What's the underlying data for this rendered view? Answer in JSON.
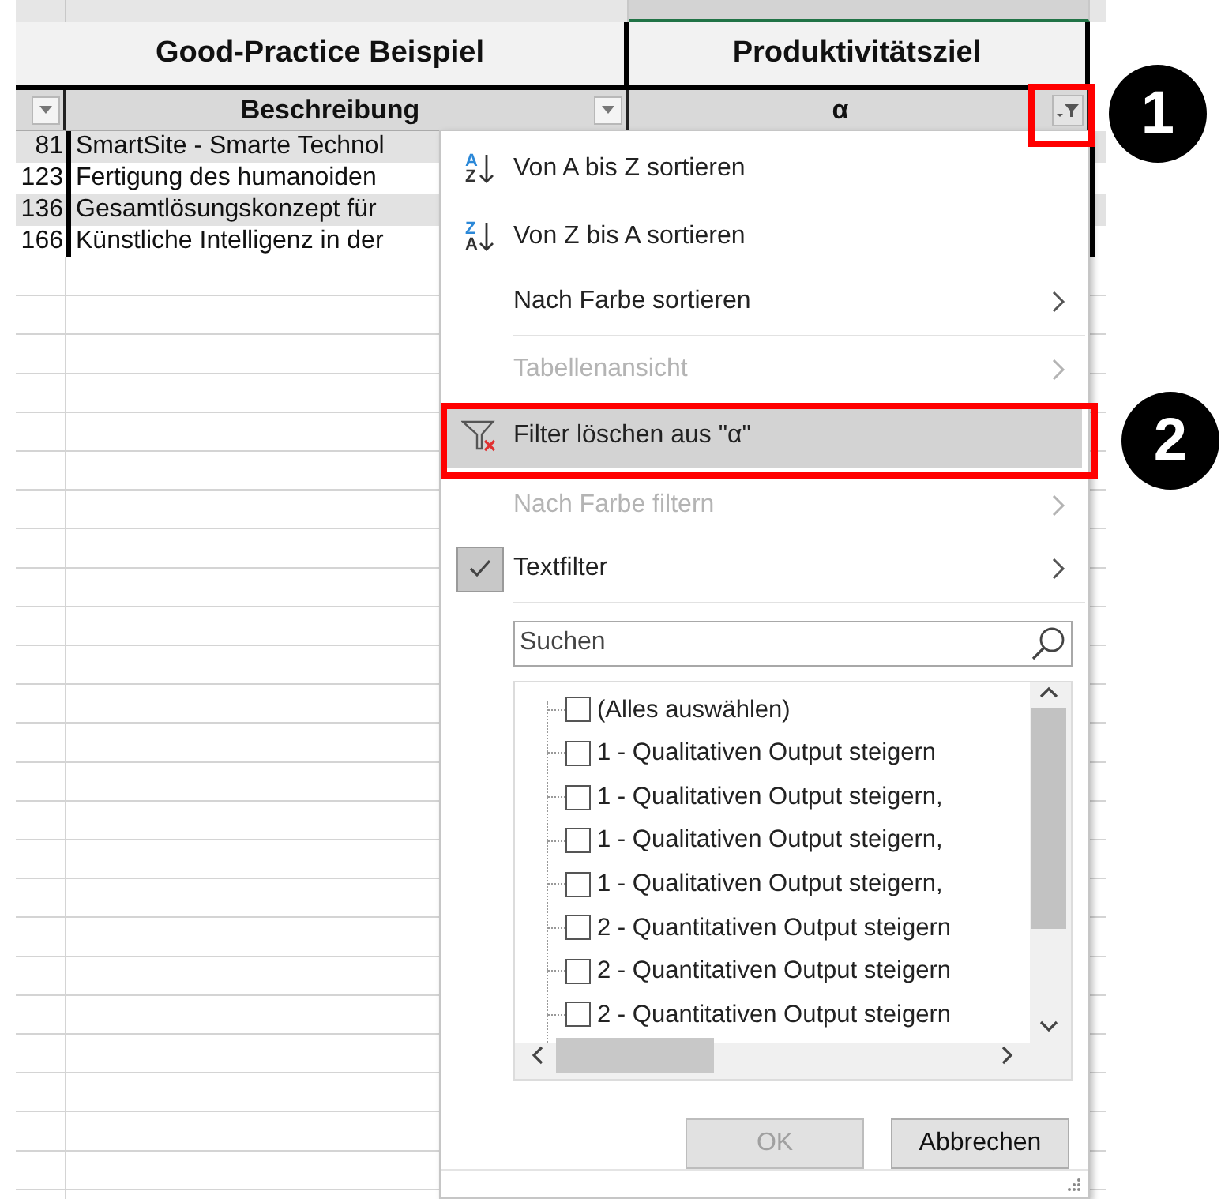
{
  "spreadsheet": {
    "group_headers": [
      {
        "text": "Good-Practice Beispiel"
      },
      {
        "text": "Produktivitätsziel"
      }
    ],
    "columns": [
      {
        "kind": "dropdown"
      },
      {
        "header": "Beschreibung",
        "kind": "dropdown"
      },
      {
        "header": "α",
        "kind": "filtered"
      }
    ],
    "rows": [
      {
        "id": "81",
        "text": "SmartSite - Smarte Technol"
      },
      {
        "id": "123",
        "text": "Fertigung des humanoiden"
      },
      {
        "id": "136",
        "text": "Gesamtlösungskonzept für"
      },
      {
        "id": "166",
        "text": "Künstliche Intelligenz in der"
      }
    ]
  },
  "filter_menu": {
    "items": [
      {
        "kind": "sort",
        "icon_text": [
          "A",
          "Z"
        ],
        "label": "Von A bis Z sortieren",
        "disabled": false,
        "checked": false,
        "selected": false
      },
      {
        "kind": "sort",
        "icon_text": [
          "Z",
          "A"
        ],
        "label": "Von Z bis A sortieren",
        "disabled": false,
        "checked": false,
        "selected": false
      },
      {
        "kind": "submenu",
        "label": "Nach Farbe sortieren",
        "disabled": false,
        "checked": false,
        "selected": false
      },
      {
        "kind": "separator"
      },
      {
        "kind": "submenu",
        "label": "Tabellenansicht",
        "disabled": true,
        "checked": false,
        "selected": false
      },
      {
        "kind": "clear_filter",
        "label": "Filter löschen aus \"α\"",
        "disabled": false,
        "checked": false,
        "selected": true
      },
      {
        "kind": "submenu",
        "label": "Nach Farbe filtern",
        "disabled": true,
        "checked": false,
        "selected": false
      },
      {
        "kind": "submenu",
        "label": "Textfilter",
        "disabled": false,
        "checked": true,
        "selected": false
      },
      {
        "kind": "separator"
      }
    ],
    "search": {
      "placeholder": "Suchen"
    },
    "values": [
      {
        "label": "(Alles auswählen)",
        "checked": false
      },
      {
        "label": "1 - Qualitativen Output steigern",
        "checked": false
      },
      {
        "label": "1 - Qualitativen Output steigern,",
        "checked": false
      },
      {
        "label": "1 - Qualitativen Output steigern,",
        "checked": false
      },
      {
        "label": "1 - Qualitativen Output steigern,",
        "checked": false
      },
      {
        "label": "2 - Quantitativen Output steigern",
        "checked": false
      },
      {
        "label": "2 - Quantitativen Output steigern",
        "checked": false
      },
      {
        "label": "2 - Quantitativen Output steigern",
        "checked": false
      }
    ],
    "buttons": [
      {
        "label": "OK",
        "disabled": true
      },
      {
        "label": "Abbrechen",
        "disabled": false
      }
    ]
  },
  "annotations": [
    {
      "number": "1"
    },
    {
      "number": "2"
    }
  ]
}
